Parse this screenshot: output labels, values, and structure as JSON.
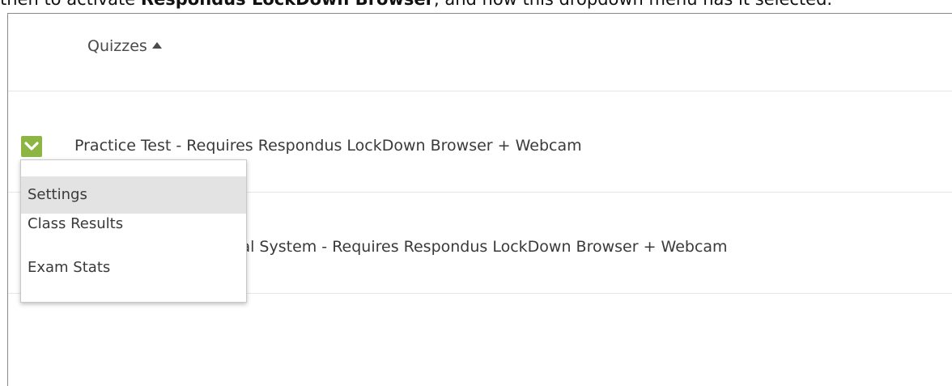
{
  "top_text": {
    "fragment_a": "then to activate ",
    "fragment_b": "Respondus LockDown Browser",
    "fragment_c": ", and how this dropdown menu has it selected."
  },
  "header": {
    "label": "Quizzes",
    "sort_direction": "ascending"
  },
  "quizzes": [
    {
      "title": "Practice Test - Requires Respondus LockDown Browser + Webcam"
    },
    {
      "title_visible": "tal System - Requires Respondus LockDown Browser + Webcam"
    }
  ],
  "dropdown": {
    "items": [
      {
        "label": "Settings",
        "highlighted": true
      },
      {
        "label": "Class Results",
        "highlighted": false
      },
      {
        "label": "Exam Stats",
        "highlighted": false
      }
    ]
  },
  "colors": {
    "accent": "#8db543",
    "highlight": "#e3e3e3"
  }
}
